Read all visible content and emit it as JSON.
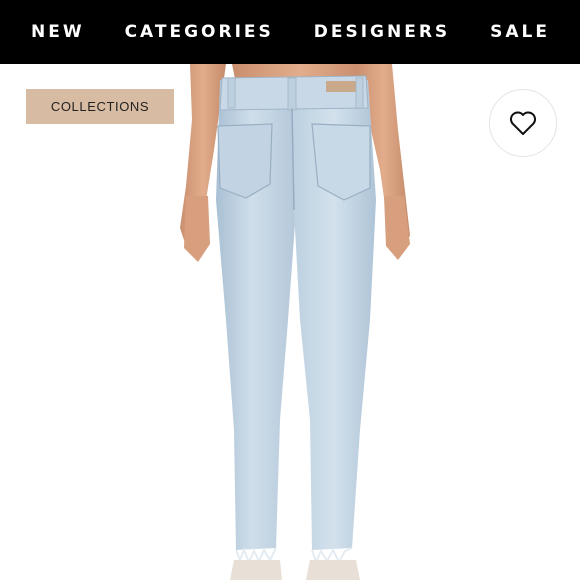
{
  "nav": {
    "items": [
      {
        "label": "NEW"
      },
      {
        "label": "CATEGORIES"
      },
      {
        "label": "DESIGNERS"
      },
      {
        "label": "SALE"
      }
    ]
  },
  "product": {
    "badge": "COLLECTIONS",
    "favorite_icon": "heart-outline-icon",
    "image_subject": "light-wash skinny jeans, back view"
  },
  "colors": {
    "nav_bg": "#000000",
    "nav_text": "#ffffff",
    "badge_bg": "#d8bba3",
    "denim": "#c3d4e2"
  }
}
